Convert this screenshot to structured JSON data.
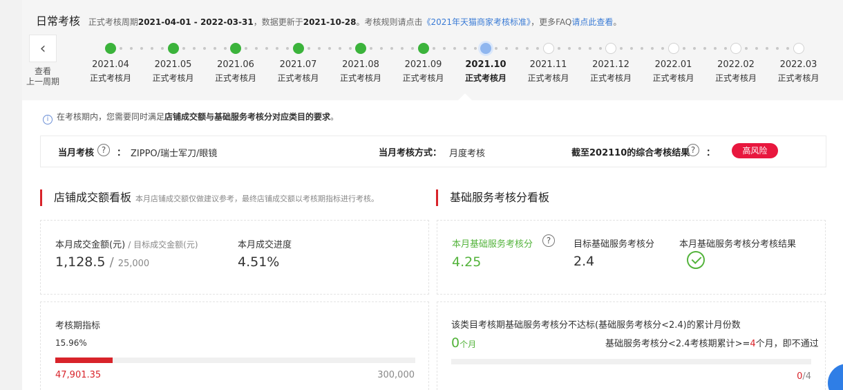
{
  "header": {
    "title": "日常考核",
    "period_prefix": "正式考核周期",
    "period": "2021-04-01 - 2022-03-31",
    "update_prefix": "，数据更新于",
    "update_date": "2021-10-28",
    "rule_prefix": "。考核规则请点击",
    "rule_link": "《2021年天猫商家考核标准》",
    "faq_prefix": "，更多FAQ",
    "faq_link": "请点此查看",
    "faq_suffix": "。"
  },
  "nav": {
    "back_line1": "查看",
    "back_line2": "上一周期"
  },
  "months": [
    {
      "label": "2021.04",
      "sub": "正式考核月",
      "state": "done"
    },
    {
      "label": "2021.05",
      "sub": "正式考核月",
      "state": "done"
    },
    {
      "label": "2021.06",
      "sub": "正式考核月",
      "state": "done"
    },
    {
      "label": "2021.07",
      "sub": "正式考核月",
      "state": "done"
    },
    {
      "label": "2021.08",
      "sub": "正式考核月",
      "state": "done"
    },
    {
      "label": "2021.09",
      "sub": "正式考核月",
      "state": "done"
    },
    {
      "label": "2021.10",
      "sub": "正式考核月",
      "state": "current"
    },
    {
      "label": "2021.11",
      "sub": "正式考核月",
      "state": "future"
    },
    {
      "label": "2021.12",
      "sub": "正式考核月",
      "state": "future"
    },
    {
      "label": "2022.01",
      "sub": "正式考核月",
      "state": "future"
    },
    {
      "label": "2022.02",
      "sub": "正式考核月",
      "state": "future"
    },
    {
      "label": "2022.03",
      "sub": "正式考核月",
      "state": "future"
    }
  ],
  "notice": {
    "part1": "在考核期内，您需要同时满足",
    "bold": "店铺成交额与基础服务考核分对应类目的要求",
    "part2": "。"
  },
  "summary": {
    "assess_label": "当月考核",
    "colon": "：",
    "category": "ZIPPO/瑞士军刀/眼镜",
    "method_label": "当月考核方式：",
    "method_value": "月度考核",
    "result_label": "截至202110的综合考核结果",
    "result_badge": "高风险"
  },
  "gmv": {
    "title": "店铺成交额看板",
    "note": "本月店铺成交额仅做建议参考，最终店铺成交额以考核期指标进行考核。",
    "month_label": "本月成交金额(元)",
    "target_label": "/ 目标成交金额(元)",
    "month_value": "1,128.5",
    "sep": "/",
    "target_value": "25,000",
    "progress_label": "本月成交进度",
    "progress_value": "4.51%",
    "period_label": "考核期指标",
    "period_percent": "15.96%",
    "period_fraction": 0.1596,
    "period_current": "47,901.35",
    "period_target": "300,000"
  },
  "service": {
    "title": "基础服务考核分看板",
    "score_label": "本月基础服务考核分",
    "score_value": "4.25",
    "target_label": "目标基础服务考核分",
    "target_value": "2.4",
    "result_label": "本月基础服务考核分考核结果",
    "fail_desc": "该类目考核期基础服务考核分不达标(基础服务考核分<2.4)的累计月份数",
    "fail_count": "0",
    "fail_unit": "个月",
    "rule_prefix": "基础服务考核分<2.4考核期累计>=",
    "rule_num": "4",
    "rule_suffix": "个月，即不通过",
    "ratio_num": "0",
    "ratio_den": "/4",
    "fail_fraction": 0
  },
  "colors": {
    "accent_red": "#d8232a",
    "green": "#53b33b",
    "link": "#3a7bd5",
    "badge": "#e8173e"
  }
}
